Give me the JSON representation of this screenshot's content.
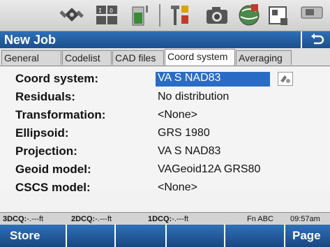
{
  "title": "New Job",
  "tabs": [
    "General",
    "Codelist",
    "CAD files",
    "Coord system",
    "Averaging"
  ],
  "fields": [
    {
      "label": "Coord system:",
      "value": "VA S NAD83"
    },
    {
      "label": "Residuals:",
      "value": "No distribution"
    },
    {
      "label": "Transformation:",
      "value": "<None>"
    },
    {
      "label": "Ellipsoid:",
      "value": "GRS 1980"
    },
    {
      "label": "Projection:",
      "value": "VA S NAD83"
    },
    {
      "label": "Geoid model:",
      "value": "VAGeoid12A GRS80"
    },
    {
      "label": "CSCS model:",
      "value": "<None>"
    }
  ],
  "status": {
    "q3_label": "3DCQ:",
    "q3_value": "-.---ft",
    "q2_label": "2DCQ:",
    "q2_value": "-.---ft",
    "q1_label": "1DCQ:",
    "q1_value": "-.---ft",
    "mode": "Fn  ABC",
    "time": "09:57am"
  },
  "softkeys": {
    "store": "Store",
    "page": "Page"
  },
  "icons": [
    "satellite-icon",
    "io-status-icon",
    "battery-icon",
    "antenna-pole-icon",
    "camera-icon",
    "globe-icon",
    "memory-icon",
    "cf-card-icon",
    "back-arrow-icon",
    "picker-icon"
  ],
  "colors": {
    "accent": "#1f5596",
    "selection": "#2a6cc5"
  }
}
